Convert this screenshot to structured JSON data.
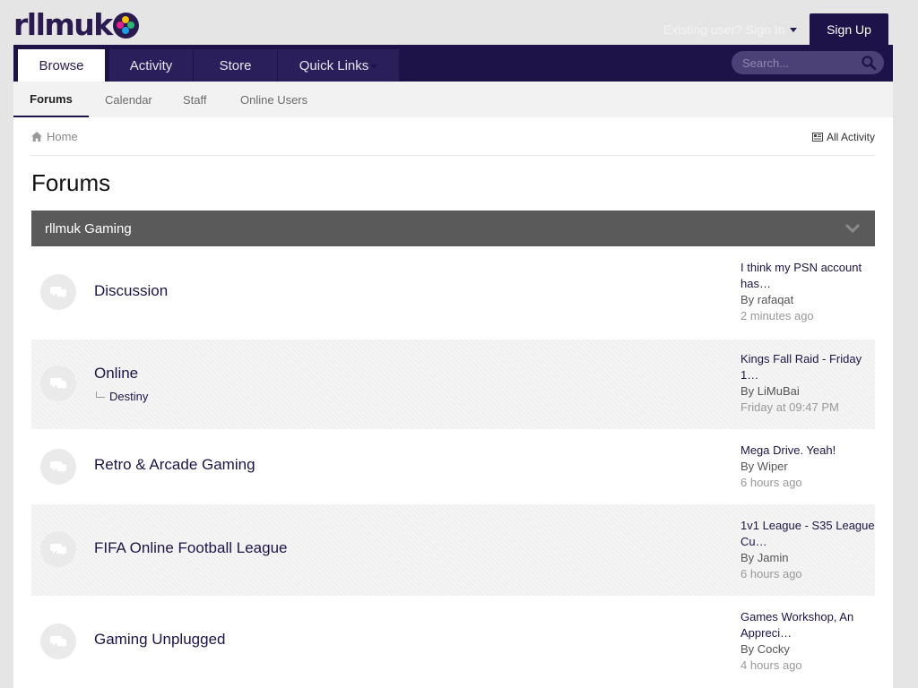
{
  "header": {
    "logo_text": "rllmuk",
    "signin_label": "Existing user? Sign In",
    "signup_label": "Sign Up"
  },
  "nav": {
    "tabs": [
      {
        "label": "Browse",
        "active": true
      },
      {
        "label": "Activity",
        "active": false
      },
      {
        "label": "Store",
        "active": false
      },
      {
        "label": "Quick Links",
        "active": false
      }
    ],
    "search_placeholder": "Search..."
  },
  "subnav": {
    "items": [
      {
        "label": "Forums",
        "active": true
      },
      {
        "label": "Calendar",
        "active": false
      },
      {
        "label": "Staff",
        "active": false
      },
      {
        "label": "Online Users",
        "active": false
      }
    ]
  },
  "breadcrumb": {
    "home_label": "Home"
  },
  "all_activity_label": "All Activity",
  "page_title": "Forums",
  "category": {
    "name": "rllmuk Gaming",
    "forums": [
      {
        "title": "Discussion",
        "subforums": [],
        "last_post": {
          "title": "I think my PSN account has…",
          "by_prefix": "By",
          "author": "rafaqat",
          "time": "2 minutes ago"
        }
      },
      {
        "title": "Online",
        "subforums": [
          "Destiny"
        ],
        "last_post": {
          "title": "Kings Fall Raid - Friday 1…",
          "by_prefix": "By",
          "author": "LiMuBai",
          "time": "Friday at 09:47 PM"
        }
      },
      {
        "title": "Retro & Arcade Gaming",
        "subforums": [],
        "last_post": {
          "title": "Mega Drive. Yeah!",
          "by_prefix": "By",
          "author": "Wiper",
          "time": "6 hours ago"
        }
      },
      {
        "title": "FIFA Online Football League",
        "subforums": [],
        "last_post": {
          "title": "1v1 League - S35 League Cu…",
          "by_prefix": "By",
          "author": "Jamin",
          "time": "6 hours ago"
        }
      },
      {
        "title": "Gaming Unplugged",
        "subforums": [],
        "last_post": {
          "title": "Games Workshop, An Appreci…",
          "by_prefix": "By",
          "author": "Cocky",
          "time": "4 hours ago"
        }
      }
    ]
  },
  "colors": {
    "brand_dark": "#1e1348",
    "category_header": "#5a5a5a",
    "page_background": "#e5e5e5"
  },
  "icons": [
    "logo-badge-icon",
    "caret-down-icon",
    "search-icon",
    "home-icon",
    "activity-icon",
    "chevron-down-icon",
    "chat-bubbles-icon",
    "subforum-elbow-icon"
  ]
}
